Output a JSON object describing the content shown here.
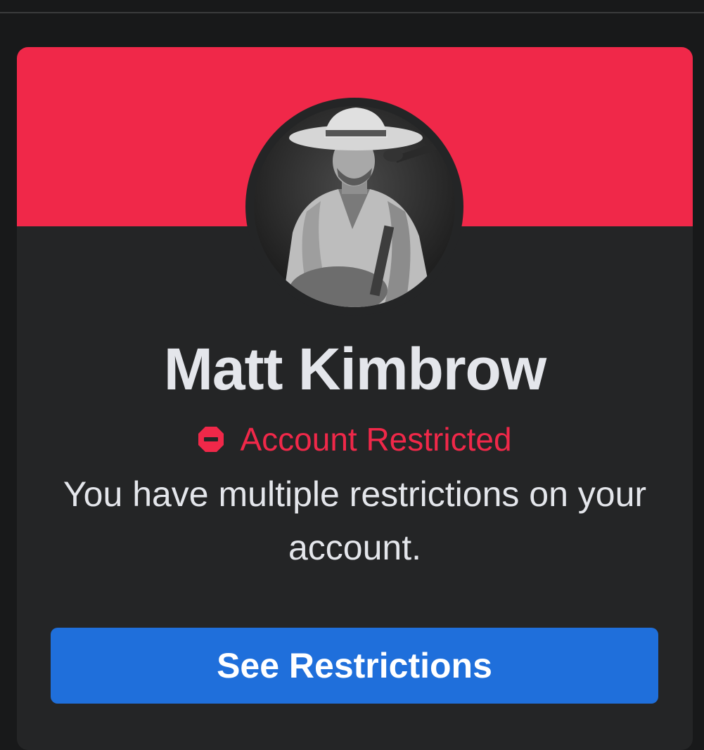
{
  "profile": {
    "name": "Matt Kimbrow",
    "status_label": "Account Restricted",
    "description": "You have multiple restrictions on your account.",
    "avatar_icon": "profile-photo"
  },
  "actions": {
    "see_restrictions_label": "See Restrictions"
  },
  "colors": {
    "banner": "#f02849",
    "status": "#f02849",
    "button": "#1f6fdb",
    "card": "#242526",
    "background": "#18191a",
    "text": "#e4e6eb"
  },
  "icons": {
    "status_icon": "stop-sign-icon"
  }
}
